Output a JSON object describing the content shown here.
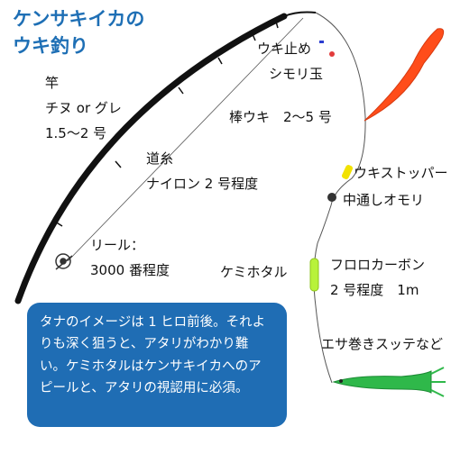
{
  "title": {
    "line1": "ケンサキイカの",
    "line2": "ウキ釣り"
  },
  "labels": {
    "rod_title": "竿",
    "rod_type": "チヌ or グレ",
    "rod_size": "1.5〜2 号",
    "line_title": "道糸",
    "line_spec": "ナイロン 2 号程度",
    "reel_title": "リール：",
    "reel_spec": "3000 番程度",
    "uki_stop": "ウキ止め",
    "simori": "シモリ玉",
    "float": "棒ウキ　2〜5 号",
    "float_stopper": "ウキストッパー",
    "sinker": "中通しオモリ",
    "glow_stick": "ケミホタル",
    "leader_title": "フロロカーボン",
    "leader_spec": "2 号程度　1m",
    "bait": "エサ巻きスッテなど"
  },
  "note": {
    "text": "タナのイメージは 1 ヒロ前後。それよりも深く狙うと、アタリがわかり難い。ケミホタルはケンサキイカへのアピールと、アタリの視認用に必須。"
  },
  "colors": {
    "title": "#1e6fb5",
    "note_bg": "#1f6db4",
    "rod": "#111111",
    "float": "#ff4d1a",
    "stopper": "#f2e200",
    "glow": "#b8f23a",
    "squid": "#2fb84a"
  },
  "icons": [
    "reel-icon",
    "float-icon",
    "sinker-icon",
    "squid-lure-icon"
  ]
}
